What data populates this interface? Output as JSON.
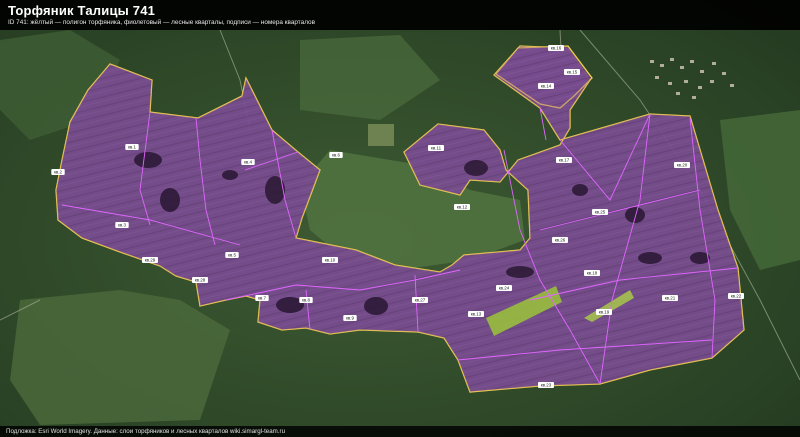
{
  "title": "Торфяник Талицы 741",
  "subtitle": "ID 741: жёлтый — полигон торфяника, фиолетовый — лесные кварталы, подписи — номера кварталов",
  "footer": "Подложка: Esri World Imagery. Данные: слои торфяников и лесных кварталов wiki.simargl-team.ru",
  "colors": {
    "peat_outline": "#f2d04a",
    "quarter_fill": "#8a4fa8",
    "quarter_line": "#e066ff",
    "meadow": "#9bc43a",
    "forest_dark": "#23381f",
    "forest_light": "#4d6c3b"
  },
  "quarter_labels": [
    "кв.1",
    "кв.2",
    "кв.3",
    "кв.4",
    "кв.5",
    "кв.6",
    "кв.7",
    "кв.8",
    "кв.9",
    "кв.10",
    "кв.11",
    "кв.12",
    "кв.13",
    "кв.14",
    "кв.15",
    "кв.16",
    "кв.17",
    "кв.18",
    "кв.19",
    "кв.20",
    "кв.21",
    "кв.22",
    "кв.23",
    "кв.24",
    "кв.25",
    "кв.26",
    "кв.27",
    "кв.28",
    "кв.29"
  ]
}
